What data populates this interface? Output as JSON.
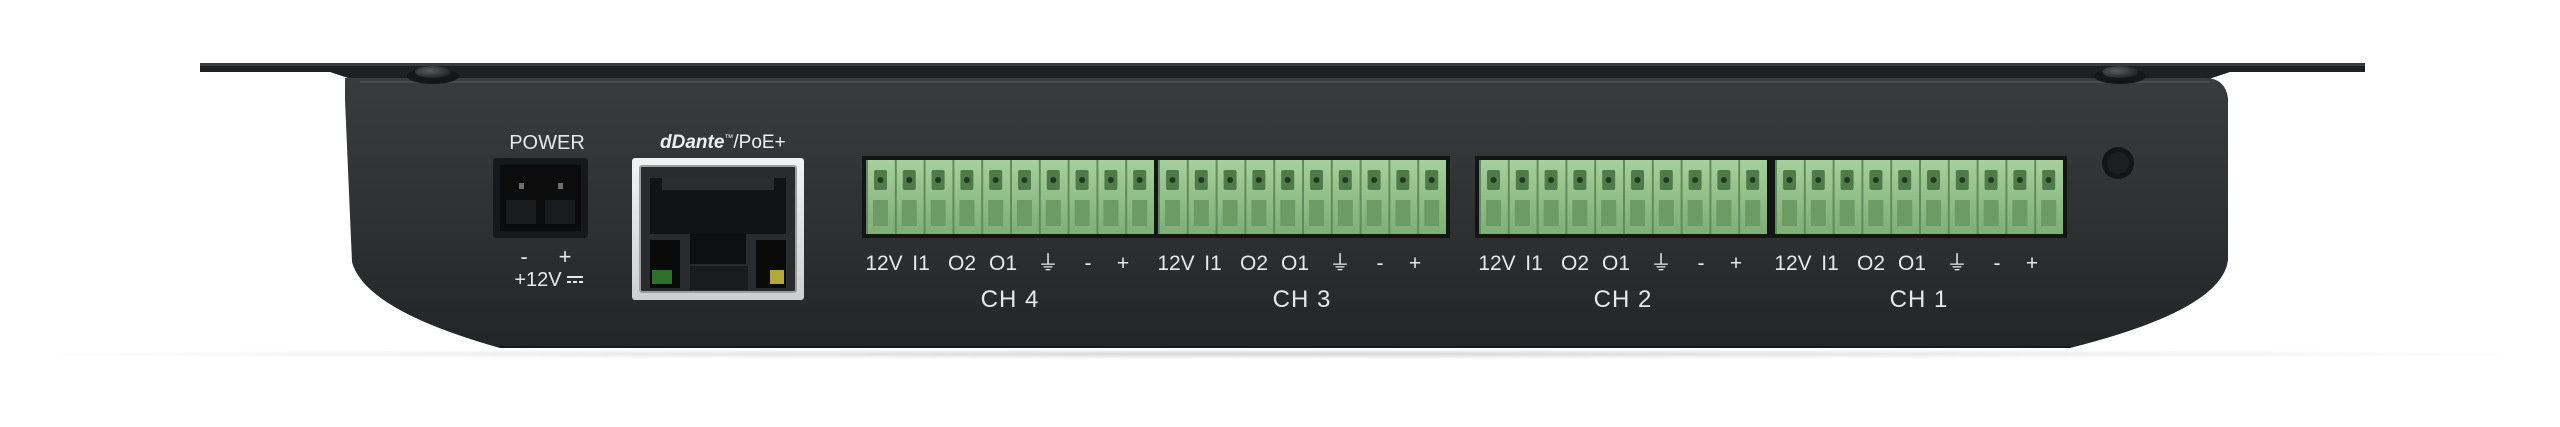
{
  "device": {
    "power": {
      "title": "POWER",
      "minus": "-",
      "plus": "+",
      "voltage": "+12V"
    },
    "network": {
      "brand": "Dante",
      "suffix": "/PoE+"
    },
    "channels": [
      {
        "name": "CH 4",
        "pins": [
          "12V",
          "I1",
          "O2",
          "O1",
          "⏚",
          "-",
          "+"
        ]
      },
      {
        "name": "CH 3",
        "pins": [
          "12V",
          "I1",
          "O2",
          "O1",
          "⏚",
          "-",
          "+"
        ]
      },
      {
        "name": "CH 2",
        "pins": [
          "12V",
          "I1",
          "O2",
          "O1",
          "⏚",
          "-",
          "+"
        ]
      },
      {
        "name": "CH 1",
        "pins": [
          "12V",
          "I1",
          "O2",
          "O1",
          "⏚",
          "-",
          "+"
        ]
      }
    ]
  },
  "colors": {
    "chassis": "#2e2f31",
    "terminal_green": "#8fbf86",
    "label_text": "#e8e8e8"
  }
}
